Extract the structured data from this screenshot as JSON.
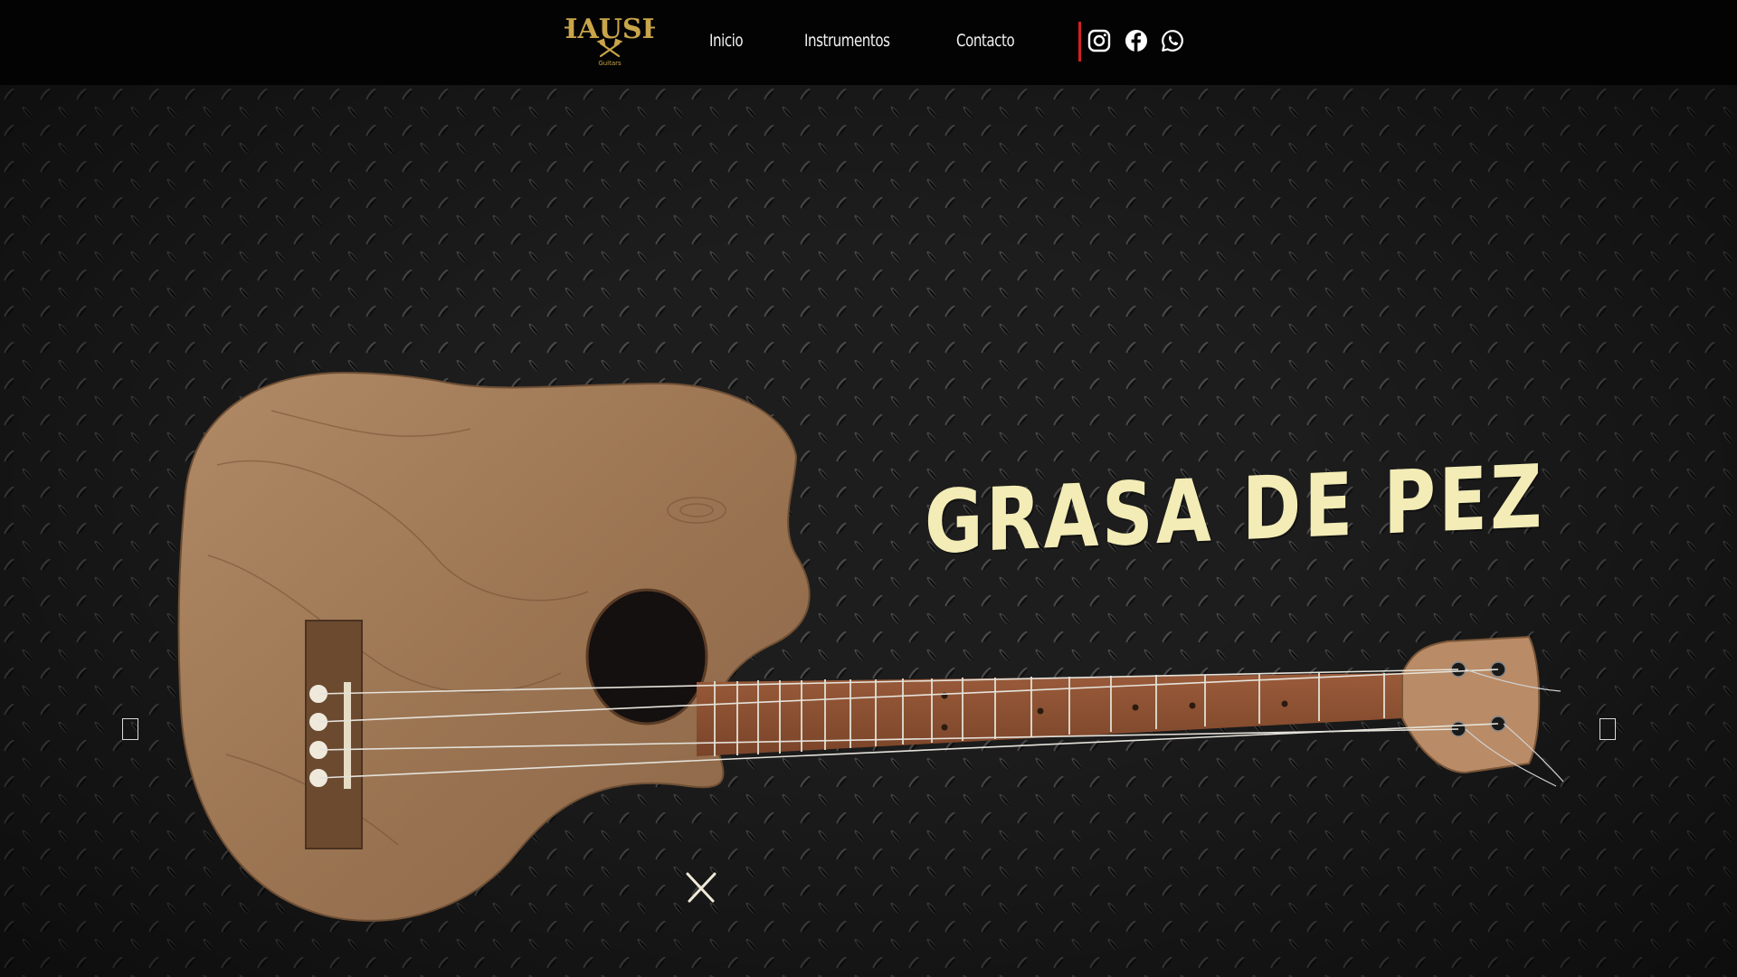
{
  "brand": {
    "name": "HAUSH",
    "tagline": "Guitars",
    "color": "#c9a54a"
  },
  "nav": {
    "items": [
      {
        "label": "Inicio"
      },
      {
        "label": "Instrumentos"
      },
      {
        "label": "Contacto"
      }
    ],
    "divider_color": "#d32020"
  },
  "social": [
    {
      "icon": "instagram-icon"
    },
    {
      "icon": "facebook-icon"
    },
    {
      "icon": "whatsapp-icon"
    }
  ],
  "hero": {
    "title": "GRASA DE PEZ",
    "title_color": "#f3ecb6",
    "slider": {
      "prev_icon": "chevron-left-icon",
      "next_icon": "chevron-right-icon"
    }
  }
}
